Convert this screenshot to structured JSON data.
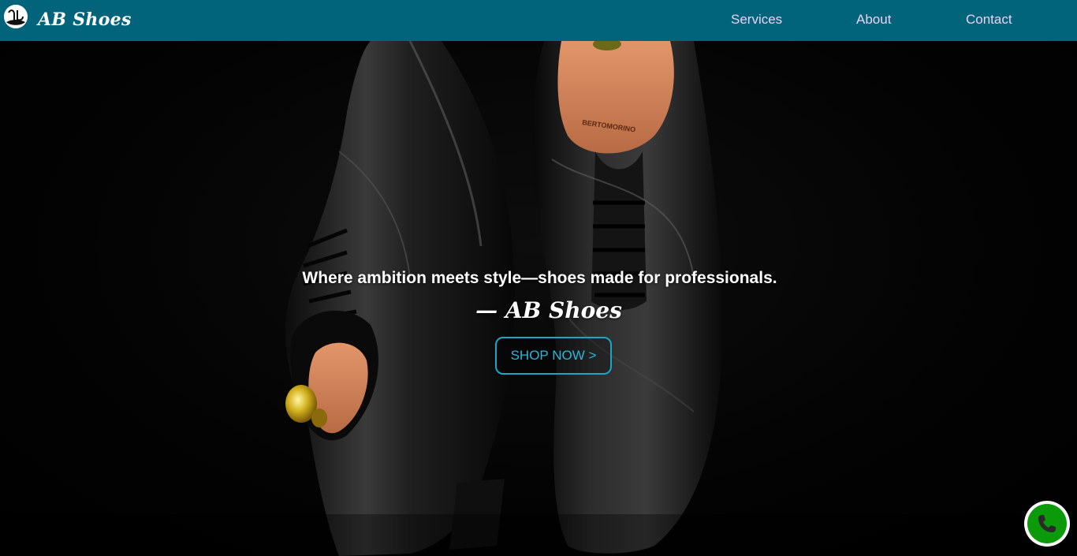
{
  "header": {
    "brand": "AB Shoes",
    "nav": [
      {
        "label": "Services"
      },
      {
        "label": "About"
      },
      {
        "label": "Contact"
      }
    ]
  },
  "hero": {
    "tagline": "Where ambition meets style—shoes made for professionals.",
    "signature": "— AB Shoes",
    "cta_label": "SHOP NOW >",
    "shoe_tree_brand": "BERTOMORINO"
  },
  "colors": {
    "navbar": "#02647b",
    "nav_link": "#e8d3f5",
    "cta_border": "#1aa6c9",
    "call_button": "#0a9a0a"
  },
  "icons": {
    "logo": "logo-icon",
    "call": "phone-icon"
  }
}
